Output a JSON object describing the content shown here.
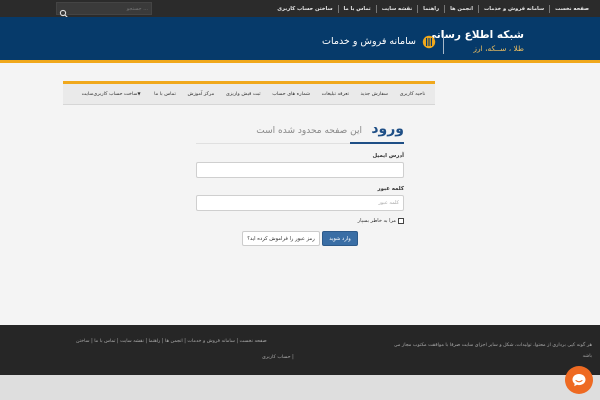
{
  "topbar": {
    "search_placeholder": "جستجو ...",
    "nav": [
      "صفحه نخست",
      "سامانه فروش و خدمات",
      "انجمن ها",
      "راهنما",
      "نقشه سایت",
      "تماس با ما",
      "ساختن حساب کاربری"
    ]
  },
  "header": {
    "brand_title": "شبکه اطلاع رسانی",
    "brand_tagline": "طلا ، ســکه، ارز",
    "subtitle": "سامانه فروش و خدمات"
  },
  "mainnav": {
    "items": [
      "ناحیه کاربری",
      "سفارش جدید",
      "تعرفه تبلیغات",
      "شماره های حساب",
      "ثبت فیش واریزی",
      "مرکز آموزش",
      "تماس با ما",
      "ساخت حساب کاربری‌سایت"
    ]
  },
  "login": {
    "title": "ورود",
    "subtitle": "این صفحه محدود شده است",
    "email_label": "آدرس ایمیل",
    "email_value": "",
    "password_label": "کلمه عبور",
    "password_placeholder": "کلمه عبور",
    "remember_label": "مرا به خاطر بسپار",
    "submit_label": "وارد شوید",
    "forgot_label": "رمز عبور را فراموش کرده اید؟"
  },
  "footer": {
    "copyright_line1": "هر گونه کپی برداری از محتوا، تولیدات، شکل و سایر اجزای سایت صرفا با موافقت مکتوب مجاز می",
    "copyright_line2": "باشد",
    "links_line1": "صفحه نخست | سامانه فروش و خدمات | انجمن ها | راهنما | نقشه سایت | تماس با ما | ساختن",
    "links_line2": "حساب کاربری |"
  },
  "colors": {
    "header_bg": "#063a6a",
    "accent": "#f0a81c",
    "primary_button": "#3a6ea5",
    "chat_button": "#ee6a22"
  },
  "icons": [
    "search-icon",
    "logo-icon",
    "dropdown-icon",
    "chat-icon"
  ]
}
